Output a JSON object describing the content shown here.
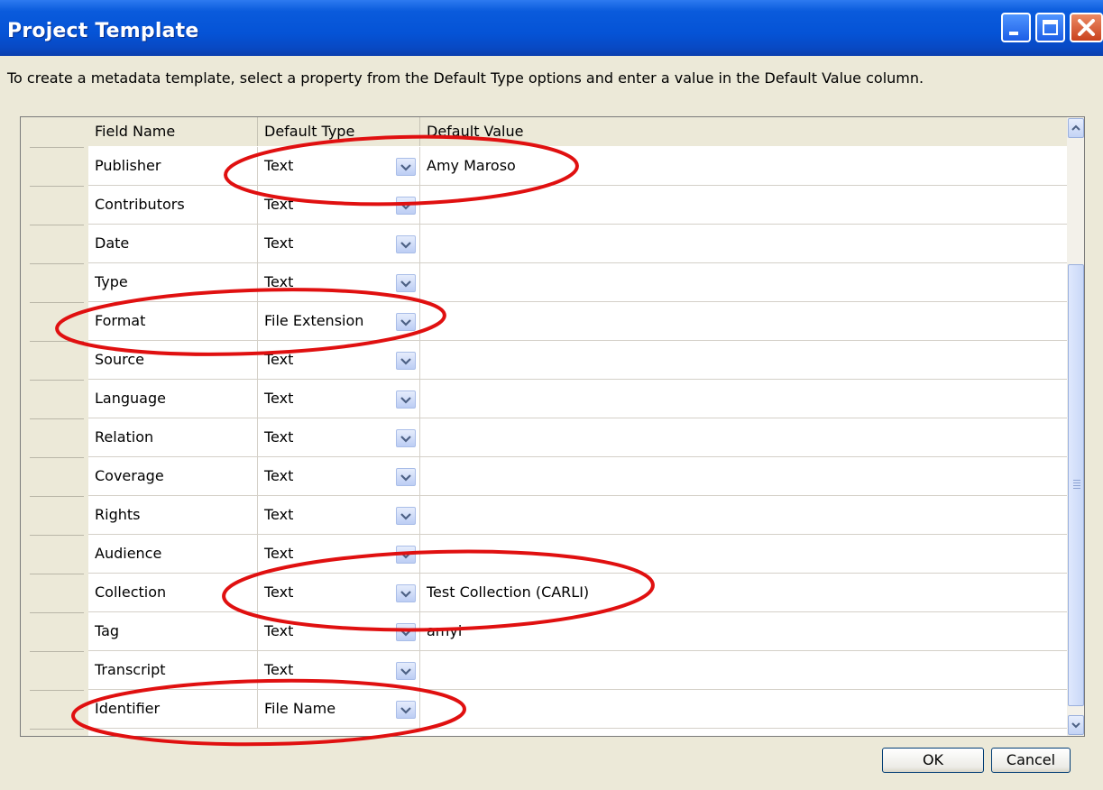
{
  "window": {
    "title": "Project Template",
    "controls": [
      "minimize-icon",
      "maximize-icon",
      "close-icon"
    ]
  },
  "instruction": "To create a metadata template, select a property from the Default Type options and enter a value in the Default Value column.",
  "table": {
    "columns": [
      "Field Name",
      "Default Type",
      "Default Value"
    ],
    "rows": [
      {
        "field": "Publisher",
        "type": "Text",
        "value": "Amy Maroso"
      },
      {
        "field": "Contributors",
        "type": "Text",
        "value": ""
      },
      {
        "field": "Date",
        "type": "Text",
        "value": ""
      },
      {
        "field": "Type",
        "type": "Text",
        "value": ""
      },
      {
        "field": "Format",
        "type": "File Extension",
        "value": ""
      },
      {
        "field": "Source",
        "type": "Text",
        "value": ""
      },
      {
        "field": "Language",
        "type": "Text",
        "value": ""
      },
      {
        "field": "Relation",
        "type": "Text",
        "value": ""
      },
      {
        "field": "Coverage",
        "type": "Text",
        "value": ""
      },
      {
        "field": "Rights",
        "type": "Text",
        "value": ""
      },
      {
        "field": "Audience",
        "type": "Text",
        "value": ""
      },
      {
        "field": "Collection",
        "type": "Text",
        "value": "Test Collection (CARLI)"
      },
      {
        "field": "Tag",
        "type": "Text",
        "value": "amyi"
      },
      {
        "field": "Transcript",
        "type": "Text",
        "value": ""
      },
      {
        "field": "Identifier",
        "type": "File Name",
        "value": ""
      }
    ]
  },
  "buttons": {
    "ok": "OK",
    "cancel": "Cancel"
  },
  "annotations": {
    "color": "#e01010",
    "circled_rows": [
      "Publisher",
      "Format",
      "Collection",
      "Identifier"
    ]
  }
}
